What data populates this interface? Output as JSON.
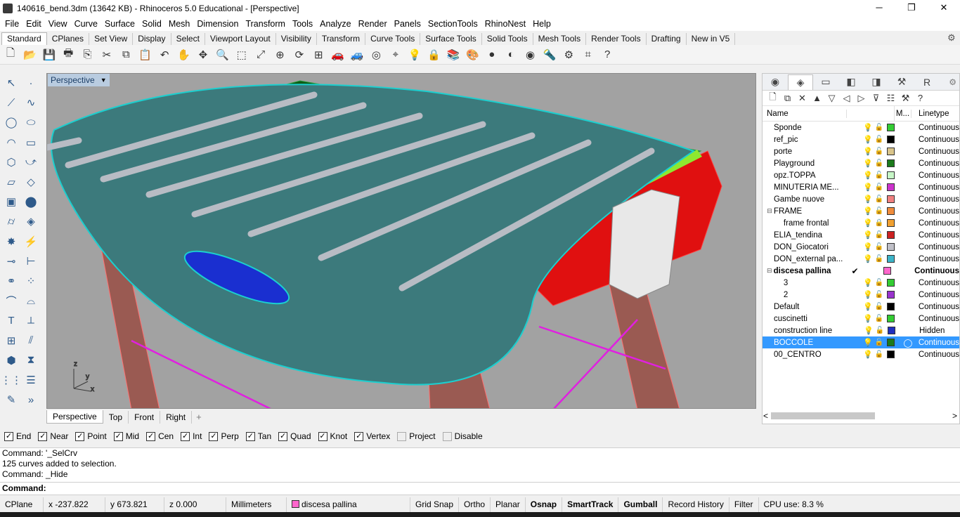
{
  "window": {
    "title": "140616_bend.3dm (13642 KB) - Rhinoceros 5.0 Educational - [Perspective]",
    "minimize": "─",
    "restore": "❐",
    "close": "✕"
  },
  "menu": [
    "File",
    "Edit",
    "View",
    "Curve",
    "Surface",
    "Solid",
    "Mesh",
    "Dimension",
    "Transform",
    "Tools",
    "Analyze",
    "Render",
    "Panels",
    "SectionTools",
    "RhinoNest",
    "Help"
  ],
  "toolbar_tabs": [
    "Standard",
    "CPlanes",
    "Set View",
    "Display",
    "Select",
    "Viewport Layout",
    "Visibility",
    "Transform",
    "Curve Tools",
    "Surface Tools",
    "Solid Tools",
    "Mesh Tools",
    "Render Tools",
    "Drafting",
    "New in V5"
  ],
  "main_tools": [
    {
      "name": "new-file-icon",
      "glyph": "🗋"
    },
    {
      "name": "open-icon",
      "glyph": "📂"
    },
    {
      "name": "save-icon",
      "glyph": "💾"
    },
    {
      "name": "print-icon",
      "glyph": "🖶"
    },
    {
      "name": "import-icon",
      "glyph": "⎘"
    },
    {
      "name": "cut-icon",
      "glyph": "✂"
    },
    {
      "name": "copy-icon",
      "glyph": "⧉"
    },
    {
      "name": "paste-icon",
      "glyph": "📋"
    },
    {
      "name": "undo-icon",
      "glyph": "↶"
    },
    {
      "name": "pan-icon",
      "glyph": "✋"
    },
    {
      "name": "rotate-view-icon",
      "glyph": "✥"
    },
    {
      "name": "zoom-icon",
      "glyph": "🔍"
    },
    {
      "name": "zoom-window-icon",
      "glyph": "⬚"
    },
    {
      "name": "zoom-extents-icon",
      "glyph": "⤢"
    },
    {
      "name": "zoom-selected-icon",
      "glyph": "⊕"
    },
    {
      "name": "rotate-icon",
      "glyph": "⟳"
    },
    {
      "name": "four-viewports-icon",
      "glyph": "⊞"
    },
    {
      "name": "car-icon",
      "glyph": "🚗"
    },
    {
      "name": "car-ghost-icon",
      "glyph": "🚙"
    },
    {
      "name": "circle-cplane-icon",
      "glyph": "◎"
    },
    {
      "name": "object-snap-icon",
      "glyph": "⌖"
    },
    {
      "name": "light-icon",
      "glyph": "💡"
    },
    {
      "name": "lock-icon",
      "glyph": "🔒"
    },
    {
      "name": "layer-icon",
      "glyph": "📚"
    },
    {
      "name": "color-wheel-icon",
      "glyph": "🎨"
    },
    {
      "name": "shaded-sphere-icon",
      "glyph": "●"
    },
    {
      "name": "rendered-sphere-icon",
      "glyph": "◐"
    },
    {
      "name": "blue-sphere-icon",
      "glyph": "◉"
    },
    {
      "name": "lamp-icon",
      "glyph": "🔦"
    },
    {
      "name": "options-gear-icon",
      "glyph": "⚙"
    },
    {
      "name": "grid-snap-icon",
      "glyph": "⌗"
    },
    {
      "name": "help-icon",
      "glyph": "?"
    }
  ],
  "left_tools": [
    [
      {
        "name": "select-arrow-icon",
        "glyph": "↖"
      },
      {
        "name": "point-icon",
        "glyph": "·"
      }
    ],
    [
      {
        "name": "polyline-icon",
        "glyph": "⟋"
      },
      {
        "name": "curve-icon",
        "glyph": "∿"
      }
    ],
    [
      {
        "name": "circle-icon",
        "glyph": "◯"
      },
      {
        "name": "ellipse-icon",
        "glyph": "⬭"
      }
    ],
    [
      {
        "name": "arc-icon",
        "glyph": "◠"
      },
      {
        "name": "rectangle-icon",
        "glyph": "▭"
      }
    ],
    [
      {
        "name": "polygon-icon",
        "glyph": "⬡"
      },
      {
        "name": "free-curve-icon",
        "glyph": "⤻"
      }
    ],
    [
      {
        "name": "surface-patch-icon",
        "glyph": "▱"
      },
      {
        "name": "loft-icon",
        "glyph": "◇"
      }
    ],
    [
      {
        "name": "box-icon",
        "glyph": "▣"
      },
      {
        "name": "sphere-solid-icon",
        "glyph": "⬤"
      }
    ],
    [
      {
        "name": "cylinder-icon",
        "glyph": "⌭"
      },
      {
        "name": "mesh-plane-icon",
        "glyph": "◈"
      }
    ],
    [
      {
        "name": "explode-icon",
        "glyph": "✸"
      },
      {
        "name": "split-icon",
        "glyph": "⚡"
      }
    ],
    [
      {
        "name": "trim-icon",
        "glyph": "⊸"
      },
      {
        "name": "extend-icon",
        "glyph": "⊢"
      }
    ],
    [
      {
        "name": "boolean-icon",
        "glyph": "⚭"
      },
      {
        "name": "group-icon",
        "glyph": "⁘"
      }
    ],
    [
      {
        "name": "fillet-icon",
        "glyph": "⌒"
      },
      {
        "name": "chamfer-icon",
        "glyph": "⌓"
      }
    ],
    [
      {
        "name": "text-icon",
        "glyph": "T"
      },
      {
        "name": "dimension-icon",
        "glyph": "⟂"
      }
    ],
    [
      {
        "name": "array-icon",
        "glyph": "⊞"
      },
      {
        "name": "mirror-icon",
        "glyph": "⫽"
      }
    ],
    [
      {
        "name": "block-icon",
        "glyph": "⬢"
      },
      {
        "name": "history-icon",
        "glyph": "⧗"
      }
    ],
    [
      {
        "name": "grid-array-icon",
        "glyph": "⋮⋮"
      },
      {
        "name": "properties-icon",
        "glyph": "☰"
      }
    ],
    [
      {
        "name": "notes-icon",
        "glyph": "✎"
      },
      {
        "name": "more-tools-icon",
        "glyph": "»"
      }
    ]
  ],
  "viewport": {
    "label": "Perspective",
    "dropdown": "▼",
    "axes": {
      "z": "z",
      "y": "y",
      "x": "x"
    },
    "tabs": [
      "Perspective",
      "Top",
      "Front",
      "Right"
    ],
    "add_tab": "+"
  },
  "layers_panel": {
    "tabs": [
      {
        "name": "properties-tab-icon",
        "glyph": "◉"
      },
      {
        "name": "layers-tab-icon",
        "glyph": "◈",
        "active": true
      },
      {
        "name": "display-tab-icon",
        "glyph": "▭"
      },
      {
        "name": "render-tab-icon",
        "glyph": "◧"
      },
      {
        "name": "materials-tab-icon",
        "glyph": "◨"
      },
      {
        "name": "help-tab-icon",
        "glyph": "⚒"
      },
      {
        "name": "rhino-tab-icon",
        "glyph": "R"
      }
    ],
    "panel_gear": "⚙",
    "tools": [
      {
        "name": "new-layer-icon",
        "glyph": "🗋"
      },
      {
        "name": "new-sublayer-icon",
        "glyph": "⧉"
      },
      {
        "name": "delete-layer-icon",
        "glyph": "✕"
      },
      {
        "name": "move-up-icon",
        "glyph": "▲"
      },
      {
        "name": "move-down-icon",
        "glyph": "▽"
      },
      {
        "name": "move-left-icon",
        "glyph": "◁"
      },
      {
        "name": "move-right-icon",
        "glyph": "▷"
      },
      {
        "name": "filter-icon",
        "glyph": "⊽"
      },
      {
        "name": "layer-states-icon",
        "glyph": "☷"
      },
      {
        "name": "tools-icon",
        "glyph": "⚒"
      },
      {
        "name": "layer-help-icon",
        "glyph": "?"
      }
    ],
    "headers": {
      "name": "Name",
      "material": "M...",
      "linetype": "Linetype"
    },
    "layers": [
      {
        "name": "Sponde",
        "color": "#33cc33",
        "linetype": "Continuous",
        "bulb": "#e8c300",
        "locked": false
      },
      {
        "name": "ref_pic",
        "color": "#000000",
        "linetype": "Continuous",
        "bulb": "#1e88e5",
        "locked": false
      },
      {
        "name": "porte",
        "color": "#d9c48a",
        "linetype": "Continuous",
        "bulb": "#e8c300",
        "locked": false
      },
      {
        "name": "Playground",
        "color": "#1b7a1b",
        "linetype": "Continuous",
        "bulb": "#e8c300",
        "locked": false
      },
      {
        "name": "opz.TOPPA",
        "color": "#c7f7c7",
        "linetype": "Continuous",
        "bulb": "#e8c300",
        "locked": false
      },
      {
        "name": "MINUTERIA ME...",
        "color": "#cc33cc",
        "linetype": "Continuous",
        "bulb": "#e8c300",
        "locked": false
      },
      {
        "name": "Gambe nuove",
        "color": "#f08080",
        "linetype": "Continuous",
        "bulb": "#e8c300",
        "locked": false
      },
      {
        "name": "FRAME",
        "color": "#f08c3c",
        "linetype": "Continuous",
        "bulb": "#e8c300",
        "locked": false,
        "expander": "⊟"
      },
      {
        "name": "frame frontal",
        "color": "#f0a030",
        "linetype": "Continuous",
        "bulb": "#e8c300",
        "locked": true,
        "indent": true
      },
      {
        "name": "ELIA_tendina",
        "color": "#cc2222",
        "linetype": "Continuous",
        "bulb": "#e8c300",
        "locked": false
      },
      {
        "name": "DON_Giocatori",
        "color": "#c0c0c8",
        "linetype": "Continuous",
        "bulb": "#e8c300",
        "locked": false
      },
      {
        "name": "DON_external pa...",
        "color": "#3cb4c8",
        "linetype": "Continuous",
        "bulb": "#e8c300",
        "locked": false
      },
      {
        "name": "discesa pallina",
        "color": "#ff66cc",
        "linetype": "Continuous",
        "bold": true,
        "current": "✔",
        "expander": "⊟"
      },
      {
        "name": "3",
        "color": "#33cc33",
        "linetype": "Continuous",
        "bulb": "#e8c300",
        "locked": false,
        "indent": true
      },
      {
        "name": "2",
        "color": "#9933cc",
        "linetype": "Continuous",
        "bulb": "#e8c300",
        "locked": false,
        "indent": true
      },
      {
        "name": "Default",
        "color": "#000000",
        "linetype": "Continuous",
        "bulb": "#e8c300",
        "locked": false
      },
      {
        "name": "cuscinetti",
        "color": "#33cc33",
        "linetype": "Continuous",
        "bulb": "#e8c300",
        "locked": false
      },
      {
        "name": "construction line",
        "color": "#1f2fbf",
        "linetype": "Hidden",
        "bulb": "#e8c300",
        "locked": false
      },
      {
        "name": "BOCCOLE",
        "color": "#1b7a1b",
        "linetype": "Continuous",
        "bulb": "#e8c300",
        "locked": false,
        "selected": true,
        "material": "◯"
      },
      {
        "name": "00_CENTRO",
        "color": "#000000",
        "linetype": "Continuous",
        "bulb": "#e8c300",
        "locked": false
      }
    ],
    "scroll_left": "<",
    "scroll_right": ">"
  },
  "osnaps": [
    {
      "label": "End",
      "checked": true
    },
    {
      "label": "Near",
      "checked": true
    },
    {
      "label": "Point",
      "checked": true
    },
    {
      "label": "Mid",
      "checked": true
    },
    {
      "label": "Cen",
      "checked": true
    },
    {
      "label": "Int",
      "checked": true
    },
    {
      "label": "Perp",
      "checked": true
    },
    {
      "label": "Tan",
      "checked": true
    },
    {
      "label": "Quad",
      "checked": true
    },
    {
      "label": "Knot",
      "checked": true
    },
    {
      "label": "Vertex",
      "checked": true
    },
    {
      "label": "Project",
      "checked": false
    },
    {
      "label": "Disable",
      "checked": false
    }
  ],
  "command_history": [
    "Command: '_SelCrv",
    "125 curves added to selection.",
    "Command: _Hide"
  ],
  "command_prompt": "Command:",
  "command_value": "",
  "statusbar": {
    "cplane": "CPlane",
    "x": "x -237.822",
    "y": "y 673.821",
    "z": "z 0.000",
    "units": "Millimeters",
    "layer": "discesa pallina",
    "layer_color": "#ff66cc",
    "grid_snap": "Grid Snap",
    "ortho": "Ortho",
    "planar": "Planar",
    "osnap": "Osnap",
    "smarttrack": "SmartTrack",
    "gumball": "Gumball",
    "record_history": "Record History",
    "filter": "Filter",
    "cpu": "CPU use: 8.3 %"
  }
}
